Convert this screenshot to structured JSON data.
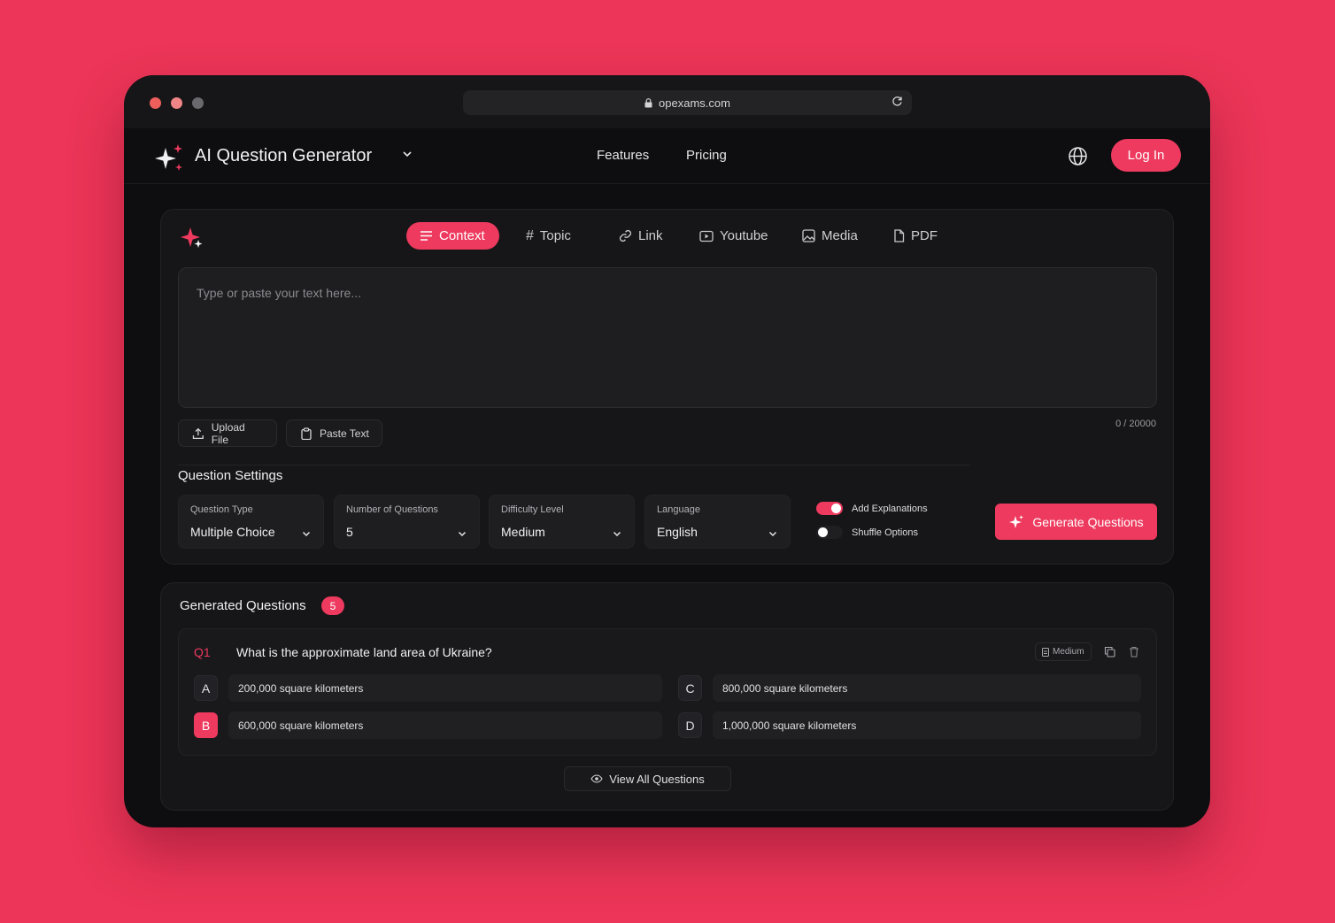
{
  "browser": {
    "url": "opexams.com"
  },
  "header": {
    "brand": "AI Question Generator",
    "nav": [
      {
        "label": "Features"
      },
      {
        "label": "Pricing"
      }
    ],
    "login_label": "Log In"
  },
  "input_panel": {
    "tabs": [
      {
        "label": "Context",
        "icon": "lines-icon",
        "active": true
      },
      {
        "label": "Topic",
        "icon": "hash-icon",
        "active": false
      },
      {
        "label": "Link",
        "icon": "link-icon",
        "active": false
      },
      {
        "label": "Youtube",
        "icon": "play-icon",
        "active": false
      },
      {
        "label": "Media",
        "icon": "image-icon",
        "active": false
      },
      {
        "label": "PDF",
        "icon": "file-icon",
        "active": false
      }
    ],
    "textarea_placeholder": "Type or paste your text here...",
    "upload_label": "Upload File",
    "paste_label": "Paste Text",
    "char_counter": "0 / 20000"
  },
  "settings": {
    "title": "Question Settings",
    "fields": [
      {
        "label": "Question Type",
        "value": "Multiple Choice"
      },
      {
        "label": "Number of Questions",
        "value": "5"
      },
      {
        "label": "Difficulty Level",
        "value": "Medium"
      },
      {
        "label": "Language",
        "value": "English"
      }
    ],
    "toggles": [
      {
        "label": "Add Explanations",
        "on": true
      },
      {
        "label": "Shuffle Options",
        "on": false
      }
    ],
    "generate_label": "Generate Questions"
  },
  "generated": {
    "title": "Generated Questions",
    "count": "5",
    "question": {
      "number": "Q1",
      "text": "What is the approximate land area of Ukraine?",
      "difficulty": "Medium",
      "options": [
        {
          "letter": "A",
          "text": "200,000 square kilometers",
          "correct": false
        },
        {
          "letter": "B",
          "text": "600,000 square kilometers",
          "correct": true
        },
        {
          "letter": "C",
          "text": "800,000 square kilometers",
          "correct": false
        },
        {
          "letter": "D",
          "text": "1,000,000 square kilometers",
          "correct": false
        }
      ]
    },
    "view_all_label": "View All Questions"
  },
  "colors": {
    "accent": "#ee3a5e",
    "background": "#ec3558",
    "window": "#0e0e10"
  }
}
